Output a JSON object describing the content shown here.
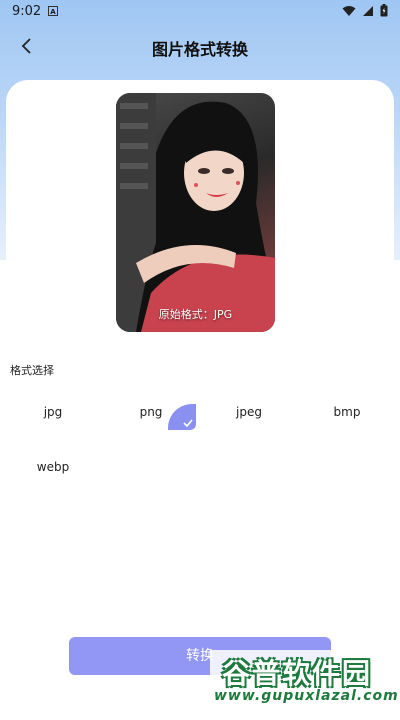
{
  "status_bar": {
    "time": "9:02",
    "app_badge": "A"
  },
  "header": {
    "title": "图片格式转换"
  },
  "preview": {
    "caption": "原始格式：JPG"
  },
  "format_section": {
    "label": "格式选择",
    "options": [
      "jpg",
      "png",
      "jpeg",
      "bmp",
      "webp"
    ],
    "selected": "png"
  },
  "actions": {
    "convert_label": "转换"
  },
  "watermark": {
    "name": "谷普软件园",
    "url": "www.gupuxlazal.com"
  },
  "colors": {
    "accent": "#9296f5",
    "selected_corner": "#8a90f0",
    "watermark": "#1d7a3c"
  }
}
